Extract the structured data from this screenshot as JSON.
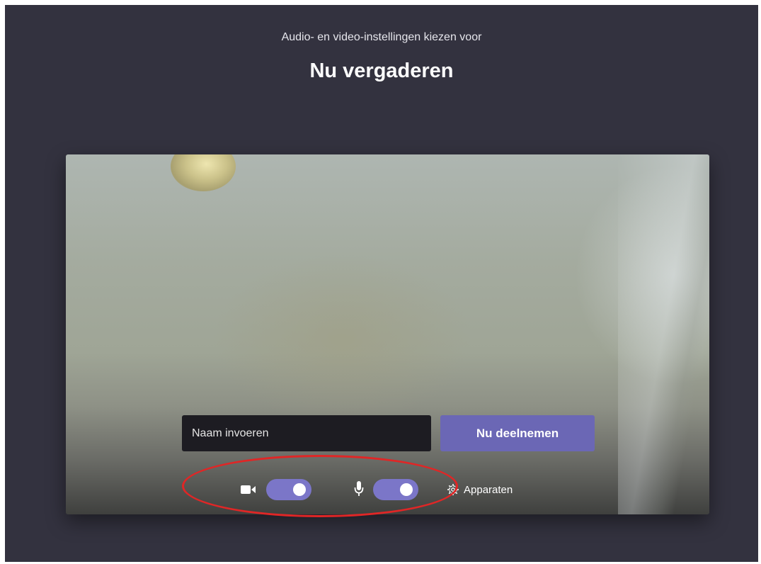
{
  "header": {
    "subtitle": "Audio- en video-instellingen kiezen voor",
    "title": "Nu vergaderen"
  },
  "join_form": {
    "name_placeholder": "Naam invoeren",
    "name_value": "",
    "join_label": "Nu deelnemen"
  },
  "controls": {
    "camera": {
      "icon": "video-camera-icon",
      "state": "on"
    },
    "microphone": {
      "icon": "microphone-icon",
      "state": "on"
    },
    "devices": {
      "icon": "gear-icon",
      "label": "Apparaten"
    }
  },
  "annotation": {
    "shape": "ellipse",
    "color": "#e02626"
  },
  "colors": {
    "background": "#33323f",
    "accent": "#6b67b5",
    "toggle_on": "#7b76c8",
    "input_bg": "#1d1c22"
  }
}
